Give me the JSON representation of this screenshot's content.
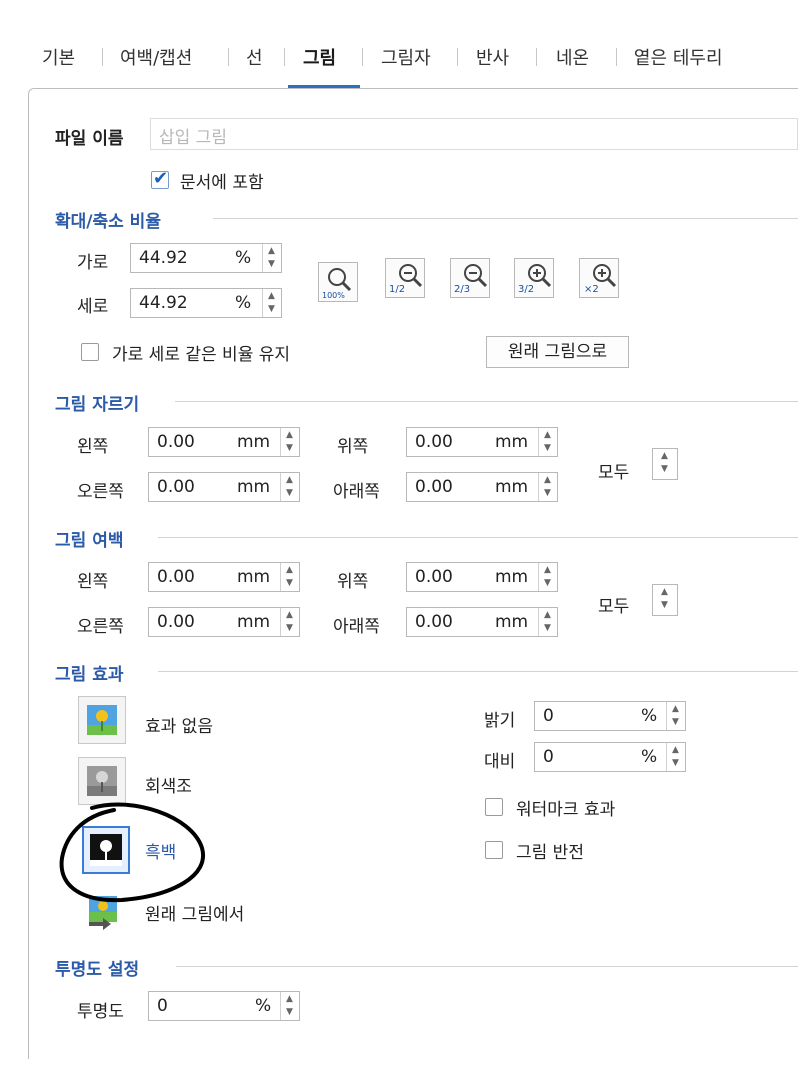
{
  "tabs": [
    {
      "label": "기본"
    },
    {
      "label": "여백/캡션"
    },
    {
      "label": "선"
    },
    {
      "label": "그림",
      "active": true
    },
    {
      "label": "그림자"
    },
    {
      "label": "반사"
    },
    {
      "label": "네온"
    },
    {
      "label": "옅은 테두리"
    }
  ],
  "file": {
    "label": "파일 이름",
    "placeholder": "삽입 그림",
    "include_label": "문서에 포함",
    "include_checked": true
  },
  "scale": {
    "title": "확대/축소 비율",
    "width_label": "가로",
    "width_value": "44.92",
    "height_label": "세로",
    "height_value": "44.92",
    "unit": "%",
    "keep_ratio_label": "가로 세로 같은 비율 유지",
    "keep_ratio_checked": false,
    "original_button": "원래 그림으로",
    "zoom_buttons": [
      {
        "name": "zoom-100-icon",
        "text": "100%"
      },
      {
        "name": "zoom-half-icon",
        "text": "1/2"
      },
      {
        "name": "zoom-two-thirds-icon",
        "text": "2/3"
      },
      {
        "name": "zoom-three-halves-icon",
        "text": "3/2"
      },
      {
        "name": "zoom-double-icon",
        "text": "×2"
      }
    ]
  },
  "crop": {
    "title": "그림 자르기",
    "left_label": "왼쪽",
    "left_value": "0.00",
    "right_label": "오른쪽",
    "right_value": "0.00",
    "top_label": "위쪽",
    "top_value": "0.00",
    "bottom_label": "아래쪽",
    "bottom_value": "0.00",
    "unit": "mm",
    "all_label": "모두"
  },
  "margin": {
    "title": "그림 여백",
    "left_label": "왼쪽",
    "left_value": "0.00",
    "right_label": "오른쪽",
    "right_value": "0.00",
    "top_label": "위쪽",
    "top_value": "0.00",
    "bottom_label": "아래쪽",
    "bottom_value": "0.00",
    "unit": "mm",
    "all_label": "모두"
  },
  "effect": {
    "title": "그림 효과",
    "options": [
      {
        "label": "효과 없음",
        "icon": "color-picture-icon",
        "selected": false
      },
      {
        "label": "회색조",
        "icon": "grayscale-picture-icon",
        "selected": false
      },
      {
        "label": "흑백",
        "icon": "black-white-picture-icon",
        "selected": true
      },
      {
        "label": "원래 그림에서",
        "icon": "restore-picture-icon",
        "selected": false
      }
    ],
    "brightness_label": "밝기",
    "brightness_value": "0",
    "contrast_label": "대비",
    "contrast_value": "0",
    "unit": "%",
    "watermark_label": "워터마크 효과",
    "watermark_checked": false,
    "invert_label": "그림 반전",
    "invert_checked": false
  },
  "transparency": {
    "title": "투명도 설정",
    "label": "투명도",
    "value": "0",
    "unit": "%"
  },
  "colors": {
    "accent": "#2b5aa8",
    "tab_underline": "#2f6fbf",
    "annotation": "#000000"
  }
}
